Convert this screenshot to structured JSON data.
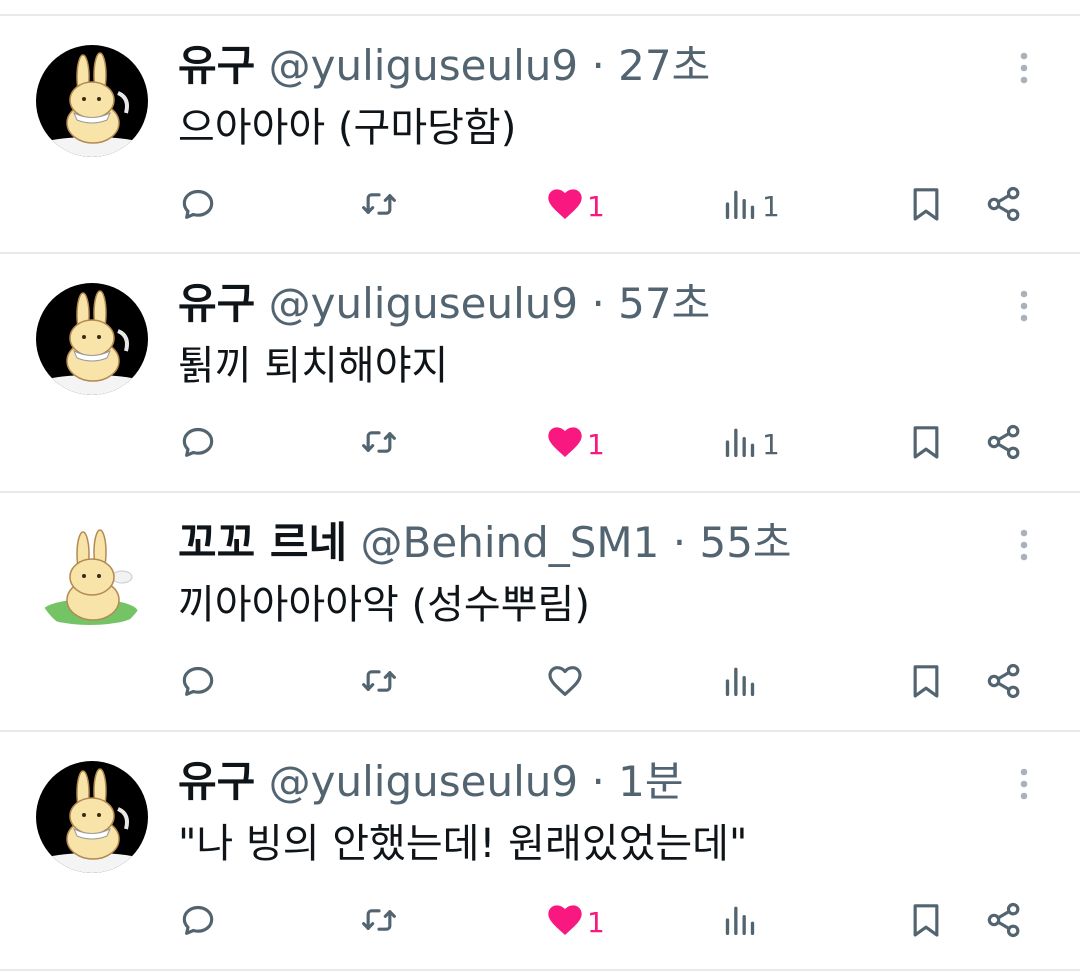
{
  "tweets": [
    {
      "name": "유구",
      "handle": "@yuliguseulu9",
      "separator": "·",
      "time": "27초",
      "text": "으아아아 (구마당함)",
      "avatar_style": "black-rabbit",
      "actions": {
        "reply": "",
        "retweet": "",
        "like": "1",
        "liked": true,
        "views": "1"
      }
    },
    {
      "name": "유구",
      "handle": "@yuliguseulu9",
      "separator": "·",
      "time": "57초",
      "text": "퇽끼 퇴치해야지",
      "avatar_style": "black-rabbit",
      "actions": {
        "reply": "",
        "retweet": "",
        "like": "1",
        "liked": true,
        "views": "1"
      }
    },
    {
      "name": "꼬꼬 르네",
      "handle": "@Behind_SM1",
      "separator": "·",
      "time": "55초",
      "text": "끼아아아아악 (성수뿌림)",
      "avatar_style": "white-rabbit-grass",
      "actions": {
        "reply": "",
        "retweet": "",
        "like": "",
        "liked": false,
        "views": ""
      }
    },
    {
      "name": "유구",
      "handle": "@yuliguseulu9",
      "separator": "·",
      "time": "1분",
      "text": "\"나 빙의 안했는데! 원래있었는데\"",
      "avatar_style": "black-rabbit",
      "actions": {
        "reply": "",
        "retweet": "",
        "like": "1",
        "liked": true,
        "views": ""
      }
    }
  ],
  "icons": {
    "reply": "reply-icon",
    "retweet": "retweet-icon",
    "like": "heart-icon",
    "views": "views-icon",
    "bookmark": "bookmark-icon",
    "share": "share-icon",
    "more": "more-icon"
  },
  "colors": {
    "name": "#0f1419",
    "meta": "#536471",
    "like_active": "#f91880",
    "divider": "#e7e9ec"
  }
}
